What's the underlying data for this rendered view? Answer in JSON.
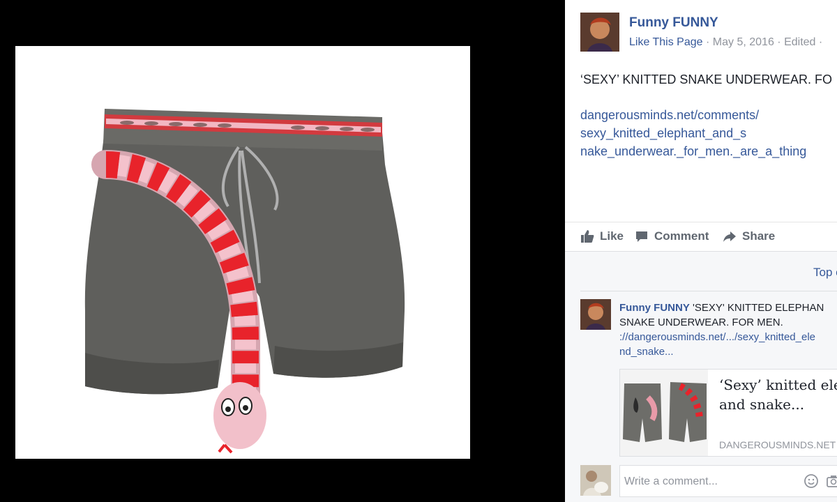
{
  "post": {
    "page_name": "Funny FUNNY",
    "like_page": "Like This Page",
    "date": "May 5, 2016",
    "edited": "Edited",
    "text": "‘SEXY’ KNITTED SNAKE UNDERWEAR. FO",
    "link_lines": [
      "dangerousminds.net/comments/",
      "sexy_knitted_elephant_and_s",
      "nake_underwear._for_men._are_a_thing"
    ]
  },
  "actions": {
    "like": "Like",
    "comment": "Comment",
    "share": "Share"
  },
  "comments": {
    "top_label": "Top c",
    "items": [
      {
        "author": "Funny FUNNY",
        "text": "'SEXY' KNITTED ELEPHAN",
        "text2": "SNAKE UNDERWEAR. FOR MEN.",
        "link1": "://dangerousminds.net/.../sexy_knitted_ele",
        "link2": "nd_snake..."
      }
    ],
    "preview": {
      "title1": "‘Sexy’ knitted ele",
      "title2": "and snake...",
      "domain": "DANGEROUSMINDS.NET"
    },
    "write_placeholder": "Write a comment..."
  },
  "icons": [
    "thumbs-up-icon",
    "speech-bubble-icon",
    "share-arrow-icon",
    "emoji-icon",
    "camera-icon"
  ],
  "colors": {
    "link": "#365899",
    "meta": "#90949c",
    "action": "#606770",
    "comments_bg": "#f6f7f9"
  }
}
